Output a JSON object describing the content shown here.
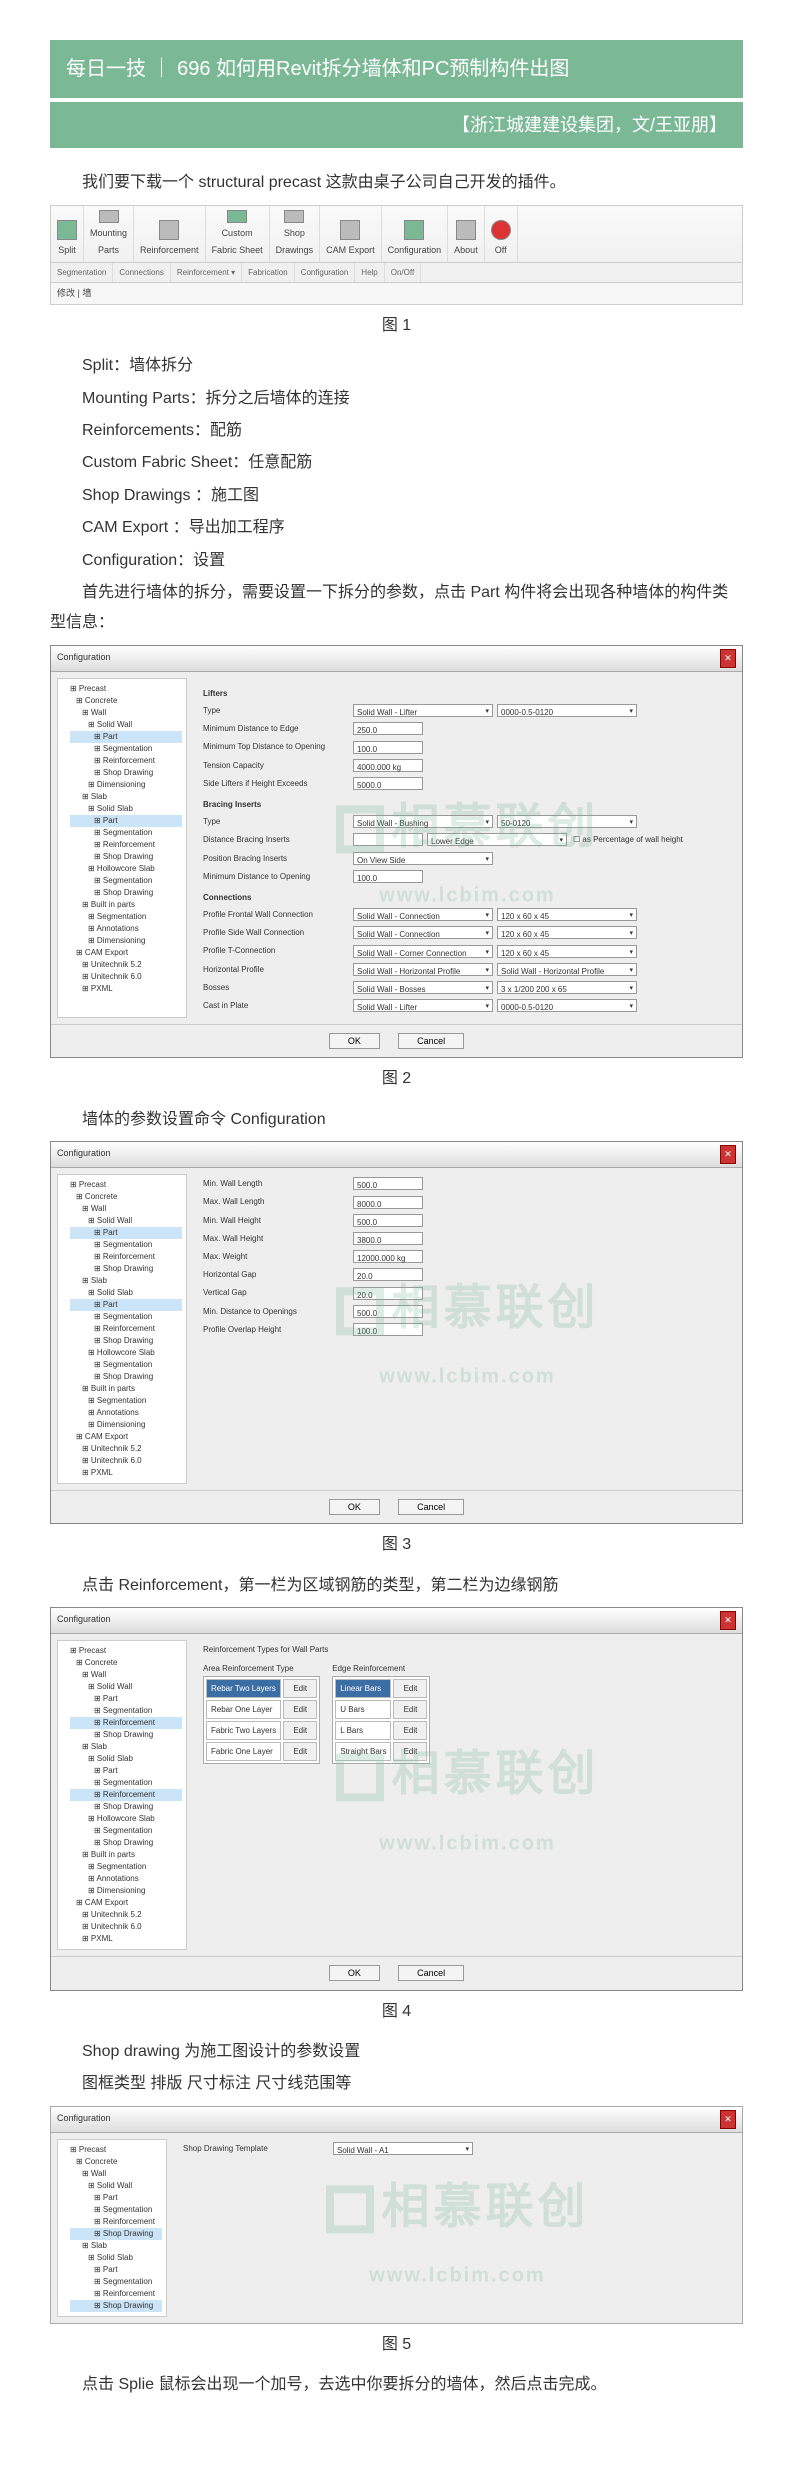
{
  "banner": {
    "title": "每日一技 ｜ 696 如何用Revit拆分墙体和PC预制构件出图",
    "subtitle": "【浙江城建建设集团，文/王亚朋】"
  },
  "intro_p1": "我们要下载一个 structural precast 这款由桌子公司自己开发的插件。",
  "ribbon": {
    "buttons": [
      {
        "name": "split",
        "label": "Split"
      },
      {
        "name": "mounting-parts",
        "label": "Mounting\nParts"
      },
      {
        "name": "reinforcement",
        "label": "Reinforcement"
      },
      {
        "name": "custom-fabric",
        "label": "Custom\nFabric Sheet"
      },
      {
        "name": "shop-drawings",
        "label": "Shop\nDrawings"
      },
      {
        "name": "cam-export",
        "label": "CAM Export"
      },
      {
        "name": "configuration",
        "label": "Configuration"
      },
      {
        "name": "about",
        "label": "About"
      },
      {
        "name": "off",
        "label": "Off"
      }
    ],
    "groups": [
      "Segmentation",
      "Connections",
      "Reinforcement ▾",
      "Fabrication",
      "Configuration",
      "Help",
      "On/Off"
    ],
    "status": "修改 | 墙"
  },
  "cap1": "图 1",
  "defs": [
    "Split：墙体拆分",
    "Mounting Parts：拆分之后墙体的连接",
    "Reinforcements：配筋",
    "Custom Fabric Sheet：任意配筋",
    "Shop Drawings ：施工图",
    "CAM Export ：导出加工程序",
    "Configuration：设置"
  ],
  "para2": "首先进行墙体的拆分，需要设置一下拆分的参数，点击 Part 构件将会出现各种墙体的构件类型信息：",
  "dlg2": {
    "title": "Configuration",
    "tree": [
      "Precast",
      " Concrete",
      "  Wall",
      "   Solid Wall",
      "    Part",
      "    Segmentation",
      "    Reinforcement",
      "    Shop Drawing",
      "   Dimensioning",
      "  Slab",
      "   Solid Slab",
      "    Part",
      "    Segmentation",
      "    Reinforcement",
      "    Shop Drawing",
      "   Hollowcore Slab",
      "    Segmentation",
      "    Shop Drawing",
      "  Built in parts",
      "   Segmentation",
      "   Annotations",
      "   Dimensioning",
      " CAM Export",
      "  Unitechnik 5.2",
      "  Unitechnik 6.0",
      "  PXML"
    ],
    "sec_lifters": "Lifters",
    "r_lifters": [
      {
        "l": "Type",
        "sel": "Solid Wall - Lifter",
        "sel2": "0000-0.5-0120"
      },
      {
        "l": "Minimum Distance to Edge",
        "v": "250.0"
      },
      {
        "l": "Minimum Top Distance to Opening",
        "v": "100.0"
      },
      {
        "l": "Tension Capacity",
        "v": "4000.000 kg"
      },
      {
        "l": "Side Lifters if Height Exceeds",
        "v": "5000.0"
      }
    ],
    "sec_bracing": "Bracing Inserts",
    "r_bracing": [
      {
        "l": "Type",
        "sel": "Solid Wall - Bushing",
        "sel2": "50-0120"
      },
      {
        "l": "Distance Bracing Inserts",
        "v": "",
        "extra": "as Percentage of wall height",
        "sel3": "Lower Edge"
      },
      {
        "l": "Position Bracing Inserts",
        "sel": "On View Side"
      },
      {
        "l": "Minimum Distance to Opening",
        "v": "100.0"
      }
    ],
    "sec_conn": "Connections",
    "r_conn": [
      {
        "l": "Profile Frontal Wall Connection",
        "sel": "Solid Wall - Connection",
        "sel2": "120 x 60 x 45"
      },
      {
        "l": "Profile Side Wall Connection",
        "sel": "Solid Wall - Connection",
        "sel2": "120 x 60 x 45"
      },
      {
        "l": "Profile T-Connection",
        "sel": "Solid Wall - Corner Connection",
        "sel2": "120 x 60 x 45"
      },
      {
        "l": "Horizontal Profile",
        "sel": "Solid Wall - Horizontal Profile",
        "sel2": "Solid Wall - Horizontal Profile"
      },
      {
        "l": "Bosses",
        "sel": "Solid Wall - Bosses",
        "sel2": "3 x 1/200 200 x 65"
      },
      {
        "l": "Cast in Plate",
        "sel": "Solid Wall - Lifter",
        "sel2": "0000-0.5-0120"
      }
    ],
    "ok": "OK",
    "cancel": "Cancel"
  },
  "cap2": "图 2",
  "para3": "墙体的参数设置命令 Configuration",
  "dlg3": {
    "title": "Configuration",
    "tree": [
      "Precast",
      " Concrete",
      "  Wall",
      "   Solid Wall",
      "    Part",
      "    Segmentation",
      "    Reinforcement",
      "    Shop Drawing",
      "  Slab",
      "   Solid Slab",
      "    Part",
      "    Segmentation",
      "    Reinforcement",
      "    Shop Drawing",
      "   Hollowcore Slab",
      "    Segmentation",
      "    Shop Drawing",
      "  Built in parts",
      "   Segmentation",
      "   Annotations",
      "   Dimensioning",
      " CAM Export",
      "  Unitechnik 5.2",
      "  Unitechnik 6.0",
      "  PXML"
    ],
    "rows": [
      {
        "l": "Min. Wall Length",
        "v": "500.0"
      },
      {
        "l": "Max. Wall Length",
        "v": "8000.0"
      },
      {
        "l": "Min. Wall Height",
        "v": "500.0"
      },
      {
        "l": "Max. Wall Height",
        "v": "3800.0"
      },
      {
        "l": "Max. Weight",
        "v": "12000.000 kg"
      },
      {
        "l": "Horizontal Gap",
        "v": "20.0"
      },
      {
        "l": "Vertical Gap",
        "v": "20.0"
      },
      {
        "l": "Min. Distance to Openings",
        "v": "500.0"
      },
      {
        "l": "Profile Overlap Height",
        "v": "100.0"
      }
    ],
    "ok": "OK",
    "cancel": "Cancel"
  },
  "cap3": "图 3",
  "para4": "点击 Reinforcement，第一栏为区域钢筋的类型，第二栏为边缘钢筋",
  "dlg4": {
    "title": "Configuration",
    "tree": [
      "Precast",
      " Concrete",
      "  Wall",
      "   Solid Wall",
      "    Part",
      "    Segmentation",
      "    Reinforcement",
      "    Shop Drawing",
      "  Slab",
      "   Solid Slab",
      "    Part",
      "    Segmentation",
      "    Reinforcement",
      "    Shop Drawing",
      "   Hollowcore Slab",
      "    Segmentation",
      "    Shop Drawing",
      "  Built in parts",
      "   Segmentation",
      "   Annotations",
      "   Dimensioning",
      " CAM Export",
      "  Unitechnik 5.2",
      "  Unitechnik 6.0",
      "  PXML"
    ],
    "head": "Reinforcement Types for Wall Parts",
    "table1_h": "Area Reinforcement Type",
    "table1": [
      {
        "t": "Rebar Two Layers",
        "hl": true
      },
      {
        "t": "Rebar One Layer"
      },
      {
        "t": "Fabric Two Layers"
      },
      {
        "t": "Fabric One Layer"
      }
    ],
    "table2_h": "Edge Reinforcement",
    "table2": [
      {
        "t": "Linear Bars",
        "hl": true
      },
      {
        "t": "U Bars"
      },
      {
        "t": "L Bars"
      },
      {
        "t": "Straight Bars"
      }
    ],
    "edit": "Edit",
    "ok": "OK",
    "cancel": "Cancel"
  },
  "cap4": "图 4",
  "para5a": "Shop drawing 为施工图设计的参数设置",
  "para5b": "图框类型 排版 尺寸标注 尺寸线范围等",
  "dlg5": {
    "title": "Configuration",
    "row": {
      "l": "Shop Drawing Template",
      "sel": "Solid Wall - A1"
    }
  },
  "cap5": "图 5",
  "para6": "点击 Splie 鼠标会出现一个加号，去选中你要拆分的墙体，然后点击完成。",
  "watermark": {
    "text": "相慕联创",
    "url": "www.lcbim.com"
  }
}
